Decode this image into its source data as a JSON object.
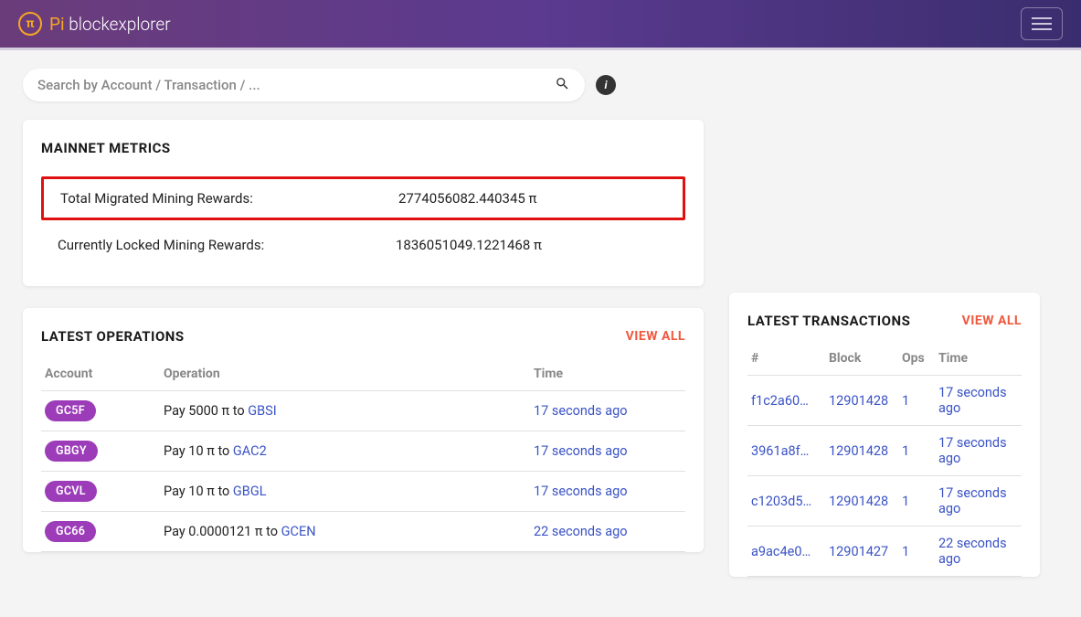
{
  "brand": {
    "pi_label": "Pi",
    "explorer_label": "blockexplorer",
    "pi_symbol": "π"
  },
  "search": {
    "placeholder": "Search by Account / Transaction / ..."
  },
  "metrics": {
    "title": "MAINNET METRICS",
    "rows": [
      {
        "label": "Total Migrated Mining Rewards:",
        "value": "2774056082.440345 π",
        "highlight": true
      },
      {
        "label": "Currently Locked Mining Rewards:",
        "value": "1836051049.1221468 π",
        "highlight": false
      }
    ]
  },
  "operations": {
    "title": "LATEST OPERATIONS",
    "view_all": "VIEW ALL",
    "headers": {
      "account": "Account",
      "operation": "Operation",
      "time": "Time"
    },
    "rows": [
      {
        "account": "GC5F",
        "op_prefix": "Pay 5000 π to ",
        "op_target": "GBSI",
        "time": "17 seconds ago"
      },
      {
        "account": "GBGY",
        "op_prefix": "Pay 10 π to ",
        "op_target": "GAC2",
        "time": "17 seconds ago"
      },
      {
        "account": "GCVL",
        "op_prefix": "Pay 10 π to ",
        "op_target": "GBGL",
        "time": "17 seconds ago"
      },
      {
        "account": "GC66",
        "op_prefix": "Pay 0.0000121 π to ",
        "op_target": "GCEN",
        "time": "22 seconds ago"
      }
    ]
  },
  "transactions": {
    "title": "LATEST TRANSACTIONS",
    "view_all": "VIEW ALL",
    "headers": {
      "hash": "#",
      "block": "Block",
      "ops": "Ops",
      "time": "Time"
    },
    "rows": [
      {
        "hash": "f1c2a60…",
        "block": "12901428",
        "ops": "1",
        "time": "17 seconds ago"
      },
      {
        "hash": "3961a8f…",
        "block": "12901428",
        "ops": "1",
        "time": "17 seconds ago"
      },
      {
        "hash": "c1203d5…",
        "block": "12901428",
        "ops": "1",
        "time": "17 seconds ago"
      },
      {
        "hash": "a9ac4e0…",
        "block": "12901427",
        "ops": "1",
        "time": "22 seconds ago"
      }
    ]
  }
}
